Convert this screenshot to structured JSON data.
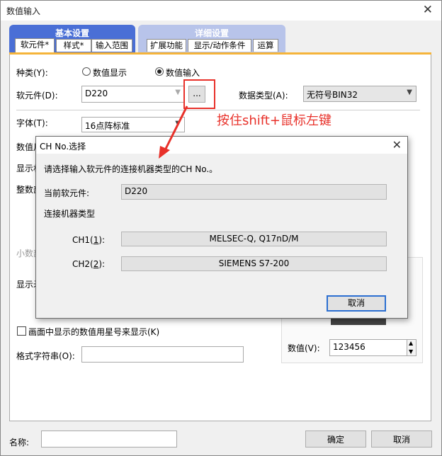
{
  "main_window": {
    "title": "数值输入",
    "close": "✕"
  },
  "tab_groups": {
    "basic": {
      "title": "基本设置",
      "tabs": [
        "软元件*",
        "样式*",
        "输入范围"
      ]
    },
    "detail": {
      "title": "详细设置",
      "tabs": [
        "扩展功能",
        "显示/动作条件",
        "运算"
      ]
    }
  },
  "form": {
    "kind_label": "种类(Y):",
    "kind_options": [
      "数值显示",
      "数值输入"
    ],
    "kind_selected": "数值输入",
    "device_label": "软元件(D):",
    "device_value": "D220",
    "browse_label": "...",
    "datatype_label": "数据类型(A):",
    "datatype_value": "无符号BIN32",
    "font_label": "字体(T):",
    "font_value": "16点阵标准",
    "partial_labels": [
      "数值尺",
      "显示林",
      "整数部",
      "小数部",
      "显示矛"
    ],
    "asterisk_checkbox": "画面中显示的数值用星号来显示(K)",
    "format_label": "格式字符串(O):",
    "format_value": "",
    "value_label": "数值(V):",
    "value_value": "123456"
  },
  "footer": {
    "name_label": "名称:",
    "name_value": "",
    "ok": "确定",
    "cancel": "取消"
  },
  "popup": {
    "title": "CH No.选择",
    "close": "✕",
    "instruction": "请选择输入软元件的连接机器类型的CH No.。",
    "current_device_label": "当前软元件:",
    "current_device_value": "D220",
    "conn_type_label": "连接机器类型",
    "ch1_label_prefix": "CH1(",
    "ch1_label_key": "1",
    "ch1_label_suffix": "):",
    "ch1_value": "MELSEC-Q, Q17nD/M",
    "ch2_label_prefix": "CH2(",
    "ch2_label_key": "2",
    "ch2_label_suffix": "):",
    "ch2_value": "SIEMENS S7-200",
    "cancel": "取消"
  },
  "annotation": {
    "text": "按住shift+鼠标左键",
    "color": "#e8312a"
  },
  "colors": {
    "tab_group_active": "#4a6fd6",
    "tab_group_inactive": "#b8c4ea",
    "panel_accent": "#f5b43a"
  }
}
